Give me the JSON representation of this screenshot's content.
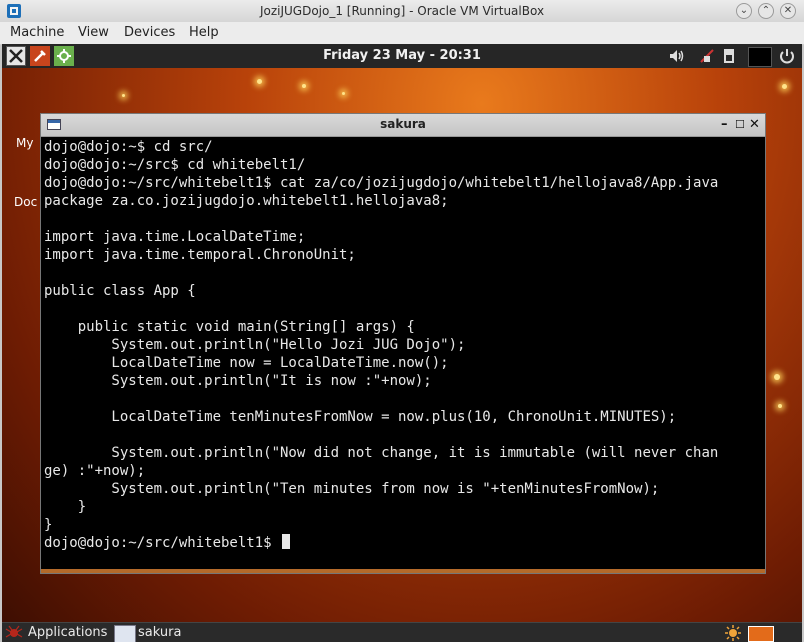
{
  "window": {
    "title": "JoziJUGDojo_1 [Running] - Oracle VM VirtualBox",
    "buttons": [
      "minimize-icon",
      "maximize-icon",
      "close-icon"
    ]
  },
  "menubar": {
    "items": [
      "Machine",
      "View",
      "Devices",
      "Help"
    ]
  },
  "guest_topbar": {
    "clock": "Friday 23 May - 20:31",
    "launchers": [
      "x-terminal-icon",
      "tools-icon",
      "puzzle-icon"
    ],
    "tray": [
      "volume-icon",
      "network-icon",
      "battery-icon",
      "screen-icon",
      "power-icon"
    ]
  },
  "desktop": {
    "labels": [
      "My",
      "Doc"
    ]
  },
  "terminal": {
    "title": "sakura",
    "lines": [
      "dojo@dojo:~$ cd src/",
      "dojo@dojo:~/src$ cd whitebelt1/",
      "dojo@dojo:~/src/whitebelt1$ cat za/co/jozijugdojo/whitebelt1/hellojava8/App.java",
      "package za.co.jozijugdojo.whitebelt1.hellojava8;",
      "",
      "import java.time.LocalDateTime;",
      "import java.time.temporal.ChronoUnit;",
      "",
      "public class App {",
      "",
      "    public static void main(String[] args) {",
      "        System.out.println(\"Hello Jozi JUG Dojo\");",
      "        LocalDateTime now = LocalDateTime.now();",
      "        System.out.println(\"It is now :\"+now);",
      "",
      "        LocalDateTime tenMinutesFromNow = now.plus(10, ChronoUnit.MINUTES);",
      "",
      "        System.out.println(\"Now did not change, it is immutable (will never chan",
      "ge) :\"+now);",
      "        System.out.println(\"Ten minutes from now is \"+tenMinutesFromNow);",
      "    }",
      "}"
    ],
    "prompt": "dojo@dojo:~/src/whitebelt1$ "
  },
  "taskbar": {
    "applications": "Applications",
    "task": "sakura"
  },
  "colors": {
    "terminal_bg": "#000000",
    "terminal_fg": "#e8e8e8",
    "desktop_accent": "#e97a1c"
  }
}
